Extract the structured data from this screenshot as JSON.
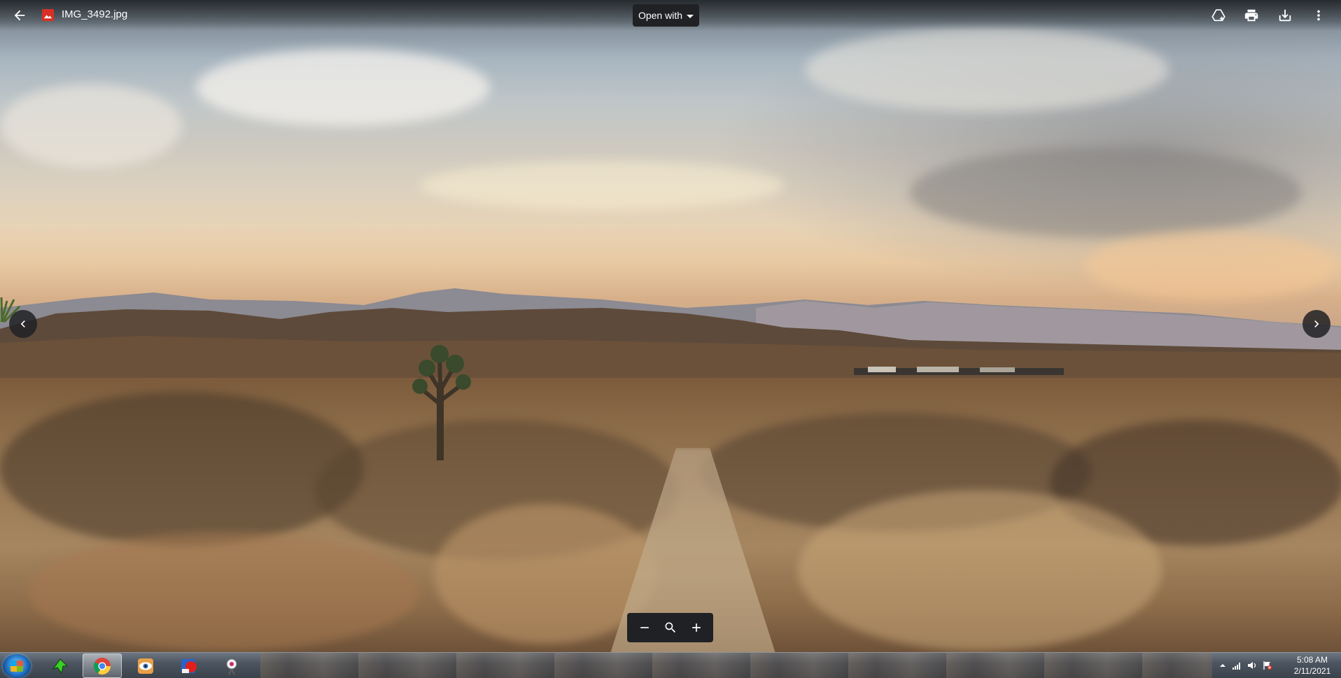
{
  "header": {
    "file_name": "IMG_3492.jpg",
    "open_with_label": "Open with",
    "icons": {
      "back": "arrow-back-icon",
      "file_type": "image-file-icon",
      "add_to_drive": "add-to-drive-icon",
      "print": "print-icon",
      "download": "download-icon",
      "more": "more-vert-icon"
    }
  },
  "navigation": {
    "prev": "chevron-left-icon",
    "next": "chevron-right-icon"
  },
  "zoom_controls": {
    "zoom_out": "minus-icon",
    "zoom_reset": "zoom-search-icon",
    "zoom_in": "plus-icon"
  },
  "taskbar": {
    "apps": [
      {
        "name": "start-orb",
        "icon": "windows-start-icon"
      },
      {
        "name": "green-arrow-app",
        "icon": "green-arrow-icon"
      },
      {
        "name": "chrome",
        "icon": "chrome-icon",
        "active": true
      },
      {
        "name": "eye-app",
        "icon": "eye-icon"
      },
      {
        "name": "paint-app",
        "icon": "paint-icon"
      },
      {
        "name": "tool-app",
        "icon": "satellite-icon"
      }
    ],
    "tray": {
      "icons": [
        "show-hidden-icons-arrow",
        "network-signal-icon",
        "volume-icon",
        "action-center-flag-icon"
      ],
      "time": "5:08 AM",
      "date": "2/11/2021"
    }
  },
  "colors": {
    "toolbar_bg": "#202124",
    "icon_fg": "#ffffff",
    "accent_red": "#d93025"
  }
}
